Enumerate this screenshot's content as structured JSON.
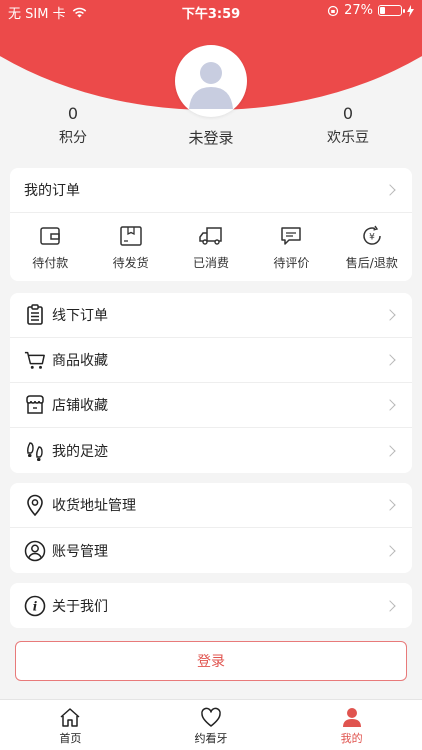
{
  "status_bar": {
    "carrier": "无 SIM 卡",
    "time": "下午3:59",
    "battery": "27%",
    "battery_level": 0.27
  },
  "profile": {
    "left_stat": {
      "value": "0",
      "label": "积分"
    },
    "login_state": "未登录",
    "right_stat": {
      "value": "0",
      "label": "欢乐豆"
    }
  },
  "orders": {
    "title": "我的订单",
    "items": [
      {
        "label": "待付款",
        "icon": "wallet-icon"
      },
      {
        "label": "待发货",
        "icon": "box-icon"
      },
      {
        "label": "已消费",
        "icon": "truck-icon"
      },
      {
        "label": "待评价",
        "icon": "comment-icon"
      },
      {
        "label": "售后/退款",
        "icon": "refund-icon"
      }
    ]
  },
  "menu1": [
    {
      "label": "线下订单",
      "icon": "clipboard-icon"
    },
    {
      "label": "商品收藏",
      "icon": "cart-icon"
    },
    {
      "label": "店铺收藏",
      "icon": "store-icon"
    },
    {
      "label": "我的足迹",
      "icon": "footprint-icon"
    }
  ],
  "menu2": [
    {
      "label": "收货地址管理",
      "icon": "location-icon"
    },
    {
      "label": "账号管理",
      "icon": "user-icon"
    }
  ],
  "menu3": [
    {
      "label": "关于我们",
      "icon": "info-icon"
    }
  ],
  "login_button": "登录",
  "tabbar": [
    {
      "label": "首页",
      "icon": "home-icon"
    },
    {
      "label": "约看牙",
      "icon": "heart-icon"
    },
    {
      "label": "我的",
      "icon": "person-icon",
      "active": true
    }
  ],
  "colors": {
    "brand_red": "#ec4a4a",
    "active_red": "#e0544f"
  }
}
